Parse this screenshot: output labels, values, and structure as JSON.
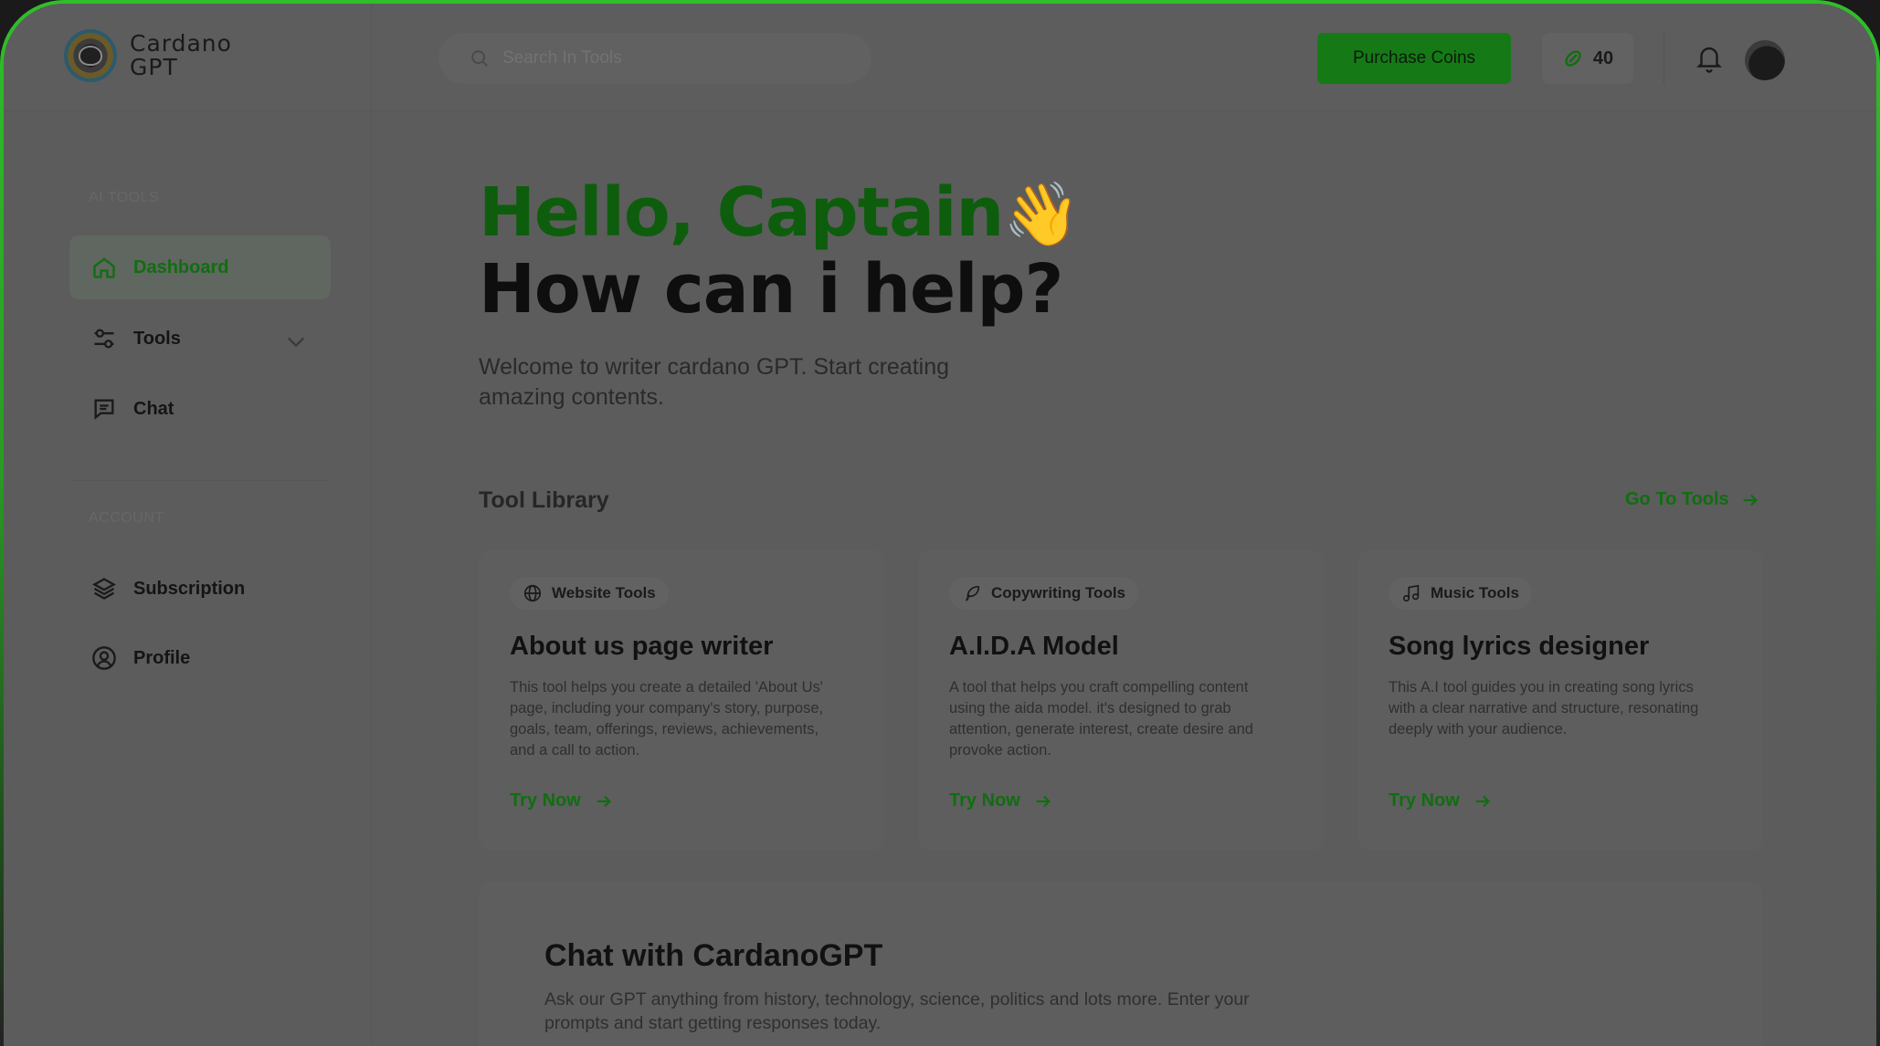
{
  "brand": {
    "name": "Cardano GPT"
  },
  "search": {
    "placeholder": "Search In Tools"
  },
  "header": {
    "purchase_label": "Purchase Coins",
    "coin_balance": "40"
  },
  "sidebar": {
    "ai_tools_label": "AI TOOLS",
    "account_label": "ACCOUNT",
    "items": [
      {
        "label": "Dashboard",
        "active": true
      },
      {
        "label": "Tools"
      },
      {
        "label": "Chat"
      },
      {
        "label": "Subscription"
      },
      {
        "label": "Profile"
      }
    ]
  },
  "hero": {
    "greeting": "Hello, Captain",
    "wave": "👋",
    "question": "How can i help?",
    "welcome": "Welcome to writer cardano GPT. Start creating amazing contents."
  },
  "library": {
    "title": "Tool Library",
    "goto_label": "Go To Tools",
    "cards": [
      {
        "tag": "Website Tools",
        "title": "About us page writer",
        "desc": "This tool helps you create a detailed 'About Us' page, including your company's story, purpose, goals, team, offerings, reviews, achievements, and a call to action.",
        "cta": "Try Now"
      },
      {
        "tag": "Copywriting Tools",
        "title": "A.I.D.A Model",
        "desc": "A tool that helps you craft compelling content using the aida model. it's designed to grab attention, generate interest, create desire and provoke action.",
        "cta": "Try Now"
      },
      {
        "tag": "Music Tools",
        "title": "Song lyrics designer",
        "desc": "This A.I tool guides you in creating song lyrics with a clear narrative and structure, resonating deeply with your audience.",
        "cta": "Try Now"
      }
    ]
  },
  "chat": {
    "title": "Chat with CardanoGPT",
    "desc": "Ask our GPT anything from history, technology, science, politics and lots more. Enter your prompts and start getting responses today."
  },
  "colors": {
    "accent": "#116d11",
    "frame": "#2fbf2a"
  }
}
